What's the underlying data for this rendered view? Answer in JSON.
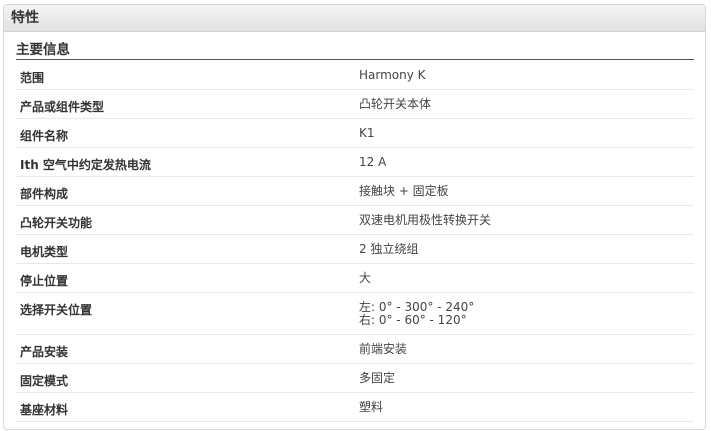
{
  "panel": {
    "title": "特性"
  },
  "section": {
    "title": "主要信息"
  },
  "rows": [
    {
      "label": "范围",
      "value": "Harmony K"
    },
    {
      "label": "产品或组件类型",
      "value": "凸轮开关本体"
    },
    {
      "label": "组件名称",
      "value": "K1"
    },
    {
      "label": "Ith 空气中约定发热电流",
      "value": "12 A"
    },
    {
      "label": "部件构成",
      "value": "接触块 + 固定板"
    },
    {
      "label": "凸轮开关功能",
      "value": "双速电机用极性转换开关"
    },
    {
      "label": "电机类型",
      "value": "2 独立绕组"
    },
    {
      "label": "停止位置",
      "value": "大"
    },
    {
      "label": "选择开关位置",
      "value_line1": "左: 0° - 300° - 240°",
      "value_line2": "右: 0° - 60° - 120°"
    },
    {
      "label": "产品安装",
      "value": "前端安装"
    },
    {
      "label": "固定模式",
      "value": "多固定"
    },
    {
      "label": "基座材料",
      "value": "塑料"
    }
  ]
}
